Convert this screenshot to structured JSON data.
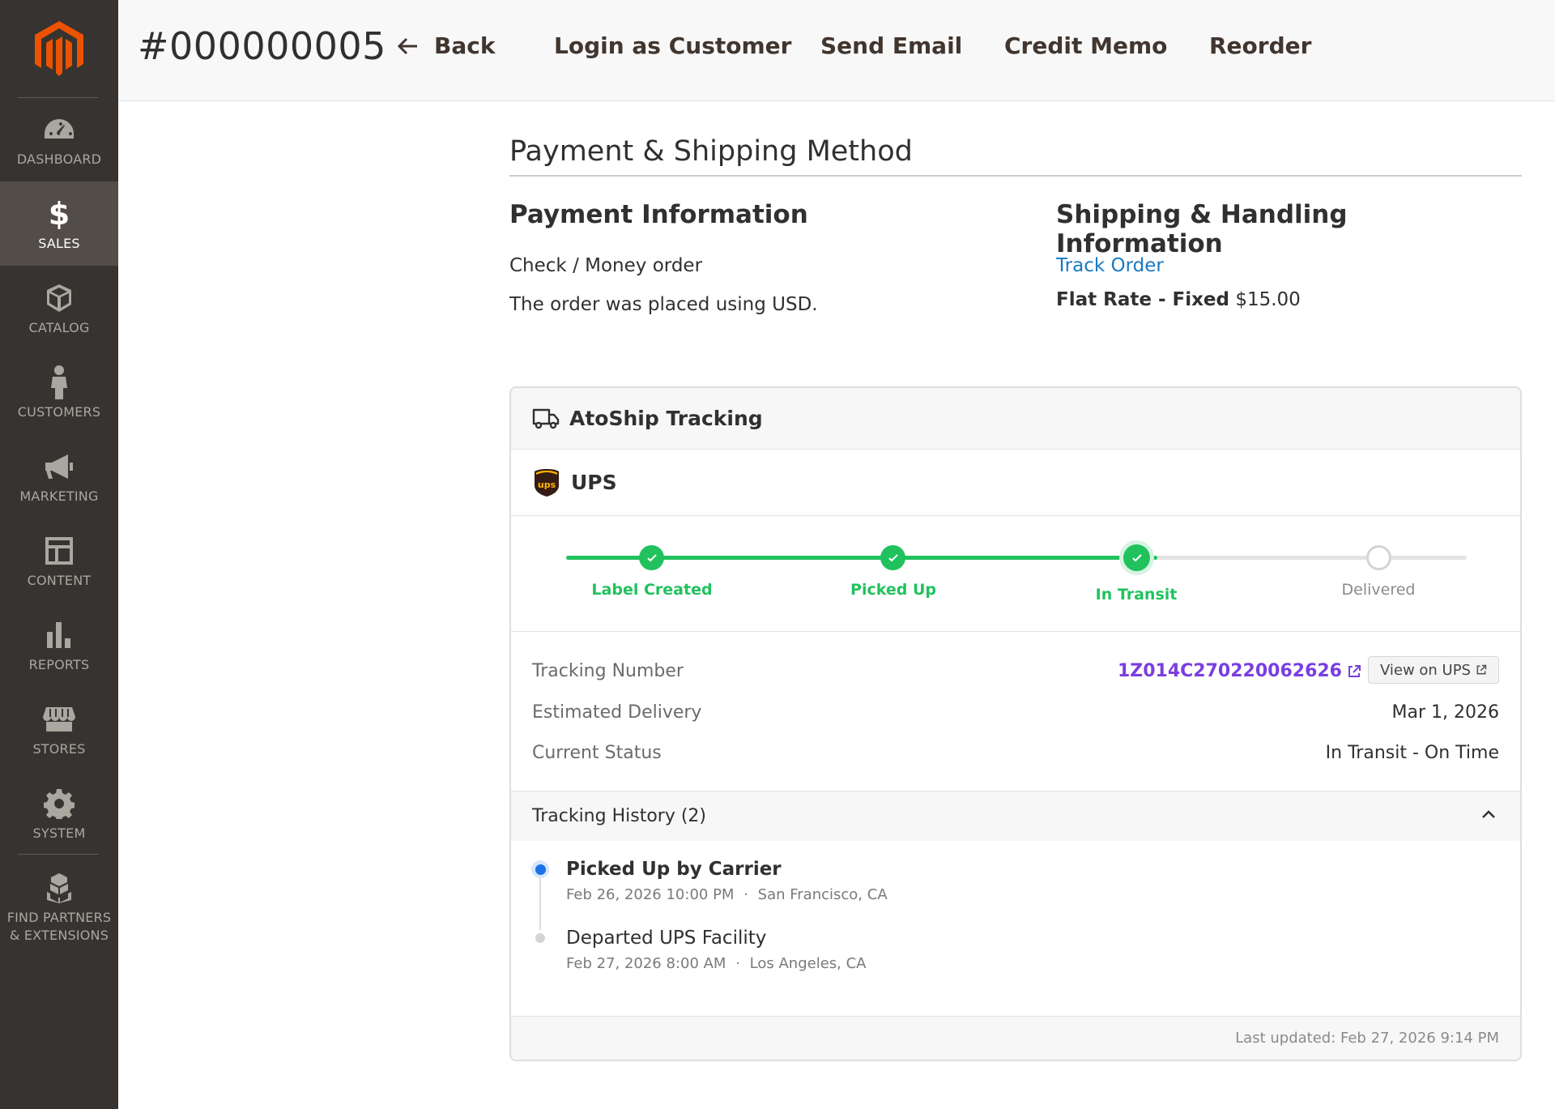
{
  "sidebar": {
    "items": [
      {
        "label": "DASHBOARD",
        "icon": "dashboard-icon"
      },
      {
        "label": "SALES",
        "icon": "dollar-icon",
        "glyph": "$"
      },
      {
        "label": "CATALOG",
        "icon": "box-icon"
      },
      {
        "label": "CUSTOMERS",
        "icon": "person-icon"
      },
      {
        "label": "MARKETING",
        "icon": "megaphone-icon"
      },
      {
        "label": "CONTENT",
        "icon": "layout-icon"
      },
      {
        "label": "REPORTS",
        "icon": "bar-chart-icon"
      },
      {
        "label": "STORES",
        "icon": "storefront-icon"
      },
      {
        "label": "SYSTEM",
        "icon": "gear-icon"
      },
      {
        "label_line1": "FIND PARTNERS",
        "label_line2": "& EXTENSIONS",
        "icon": "blocks-icon"
      }
    ],
    "active": "SALES"
  },
  "header": {
    "order_id": "#000000005",
    "buttons": {
      "back": "Back",
      "login_as_customer": "Login as Customer",
      "send_email": "Send Email",
      "credit_memo": "Credit Memo",
      "reorder": "Reorder"
    }
  },
  "section": {
    "title": "Payment & Shipping Method",
    "payment": {
      "title": "Payment Information",
      "method": "Check / Money order",
      "currency_note": "The order was placed using USD."
    },
    "shipping": {
      "title": "Shipping & Handling Information",
      "track_link": "Track Order",
      "method_label": "Flat Rate - Fixed",
      "method_price": "$15.00"
    }
  },
  "tracking": {
    "title": "AtoShip Tracking",
    "carrier": "UPS",
    "steps": [
      {
        "label": "Label Created",
        "state": "done"
      },
      {
        "label": "Picked Up",
        "state": "done"
      },
      {
        "label": "In Transit",
        "state": "current"
      },
      {
        "label": "Delivered",
        "state": "pending"
      }
    ],
    "details": {
      "tracking_number_label": "Tracking Number",
      "tracking_number": "1Z014C270220062626",
      "view_button": "View on UPS",
      "estimated_delivery_label": "Estimated Delivery",
      "estimated_delivery": "Mar 1, 2026",
      "current_status_label": "Current Status",
      "current_status": "In Transit - On Time"
    },
    "history": {
      "title": "Tracking History (2)",
      "events": [
        {
          "title": "Picked Up by Carrier",
          "datetime": "Feb 26, 2026 10:00 PM",
          "location": "San Francisco, CA"
        },
        {
          "title": "Departed UPS Facility",
          "datetime": "Feb 27, 2026 8:00 AM",
          "location": "Los Angeles, CA"
        }
      ]
    },
    "last_updated": "Last updated: Feb 27, 2026 9:14 PM"
  },
  "colors": {
    "sidebar_bg": "#373330",
    "sidebar_active": "#524d49",
    "magento_orange": "#eb5202",
    "success_green": "#21c25e",
    "link_blue": "#1979c3",
    "tracking_purple": "#7a3ee0",
    "ups_brown": "#351c15",
    "ups_gold": "#ffb500"
  }
}
